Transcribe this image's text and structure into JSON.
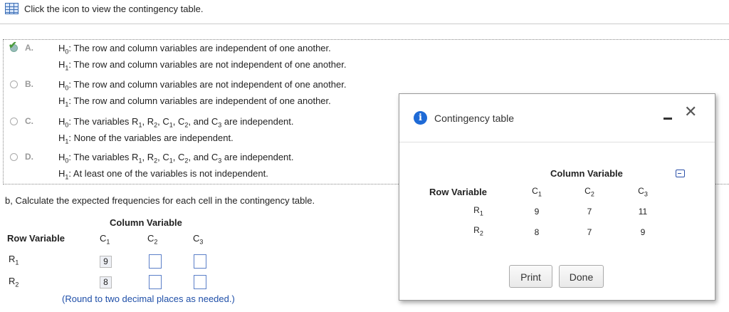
{
  "intro": {
    "text": "Click the icon to view the contingency table."
  },
  "options": [
    {
      "letter": "A.",
      "h0_prefix": "H",
      "h0_sub": "0",
      "h0_text": ": The row and column variables are independent of one another.",
      "h1_prefix": "H",
      "h1_sub": "1",
      "h1_text": ": The row and column variables are not independent of one another.",
      "selected": true
    },
    {
      "letter": "B.",
      "h0_prefix": "H",
      "h0_sub": "0",
      "h0_text": ": The row and column variables are not independent of one another.",
      "h1_prefix": "H",
      "h1_sub": "1",
      "h1_text": ": The row and column variables are independent of one another.",
      "selected": false
    },
    {
      "letter": "C.",
      "h0_prefix": "H",
      "h0_sub": "0",
      "h0_text": ": The variables R",
      "h1_prefix": "H",
      "h1_sub": "1",
      "h1_text": ": None of the variables are independent.",
      "selected": false
    },
    {
      "letter": "D.",
      "h0_prefix": "H",
      "h0_sub": "0",
      "h0_text": ": The variables R",
      "h1_prefix": "H",
      "h1_sub": "1",
      "h1_text": ": At least one of the variables is not independent.",
      "selected": false
    }
  ],
  "vars": {
    "r": "R",
    "c": "C",
    "s1": "1",
    "s2": "2",
    "s3": "3",
    "comma": ", ",
    "and": ", and ",
    "indep": " are independent."
  },
  "question": "b, Calculate the expected frequencies for each cell in the contingency table.",
  "answer_table": {
    "column_variable": "Column Variable",
    "row_variable": "Row Variable",
    "given": [
      "9",
      "8"
    ]
  },
  "hint": "(Round to two decimal places as needed.)",
  "dialog": {
    "title": "Contingency table",
    "column_variable": "Column Variable",
    "row_variable": "Row Variable",
    "rows": [
      {
        "label": "R",
        "sub": "1",
        "values": [
          "9",
          "7",
          "11"
        ]
      },
      {
        "label": "R",
        "sub": "2",
        "values": [
          "8",
          "7",
          "9"
        ]
      }
    ],
    "print_label": "Print",
    "done_label": "Done"
  }
}
